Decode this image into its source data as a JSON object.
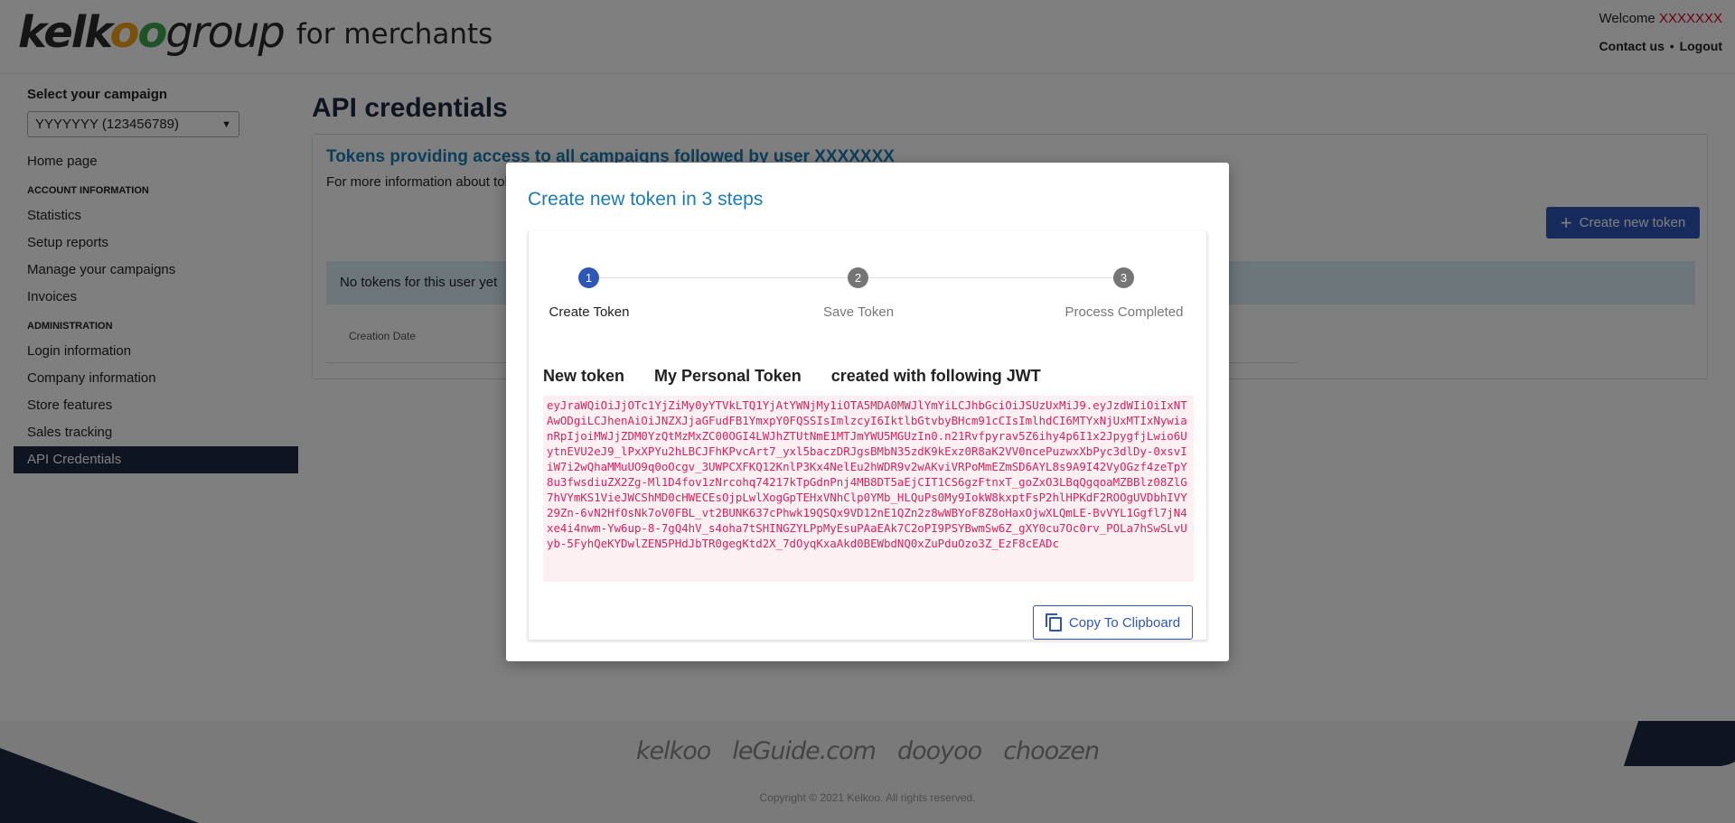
{
  "header": {
    "logo_brand": "kelkoo",
    "logo_group": "group",
    "logo_sub": "for merchants",
    "welcome_label": "Welcome",
    "welcome_user": "XXXXXXX",
    "contact_label": "Contact us",
    "separator": "•",
    "logout_label": "Logout"
  },
  "sidebar": {
    "campaign_label": "Select your campaign",
    "campaign_selected": "YYYYYYY (123456789)",
    "home": "Home page",
    "section_account": "ACCOUNT INFORMATION",
    "account_items": [
      "Statistics",
      "Setup reports",
      "Manage your campaigns",
      "Invoices"
    ],
    "section_admin": "ADMINISTRATION",
    "admin_items": [
      "Login information",
      "Company information",
      "Store features",
      "Sales tracking",
      "API Credentials"
    ]
  },
  "main": {
    "page_title": "API credentials",
    "card_title": "Tokens providing access to all campaigns followed by user XXXXXXX",
    "card_info": "For more information about toke",
    "create_button": "Create new token",
    "notice": "No tokens for this user yet",
    "column_creation_date": "Creation Date"
  },
  "footer": {
    "partners": [
      "kelkoo",
      "leGuide.com",
      "dooyoo",
      "choozen"
    ],
    "copyright": "Copyright © 2021 Kelkoo. All rights reserved."
  },
  "modal": {
    "title": "Create new token in 3 steps",
    "steps": [
      {
        "number": "1",
        "label": "Create Token",
        "active": true
      },
      {
        "number": "2",
        "label": "Save Token",
        "active": false
      },
      {
        "number": "3",
        "label": "Process Completed",
        "active": false
      }
    ],
    "heading_new_token": "New token",
    "heading_token_name": "My Personal Token",
    "heading_created_with": "created with following JWT",
    "jwt": "eyJraWQiOiJjOTc1YjZiMy0yYTVkLTQ1YjAtYWNjMy1iOTA5MDA0MWJlYmYiLCJhbGciOiJSUzUxMiJ9.eyJzdWIiOiIxNTAwODgiLCJhenAiOiJNZXJjaGFudFB1YmxpY0FQSSIsImlzcyI6IktlbGtvbyBHcm91cCIsImlhdCI6MTYxNjUxMTIxNywianRpIjoiMWJjZDM0YzQtMzMxZC00OGI4LWJhZTUtNmE1MTJmYWU5MGUzIn0.n21Rvfpyrav5Z6ihy4p6I1x2JpygfjLwio6UytnEVU2eJ9_lPxXPYu2hLBCJFhKPvcArt7_yxl5baczDRJgsBMbN35zdK9kExz0R8aK2VV0ncePuzwxXbPyc3dlDy-0xsvIiW7i2wQhaMMuUO9q0oOcgv_3UWPCXFKQ12KnlP3Kx4NelEu2hWDR9v2wAKviVRPoMmEZmSD6AYL8s9A9I42VyOGzf4zeTpY8u3fwsdiuZX2Zg-Ml1D4fov1zNrcohq74217kTpGdnPnj4MB8DT5aEjCIT1CS6gzFtnxT_goZxO3LBqQgqoaMZBBlz08ZlG7hVYmKS1VieJWCShMD0cHWECEsOjpLwlXogGpTEHxVNhClp0YMb_HLQuPs0My9IokW8kxptFsP2hlHPKdF2ROOgUVDbhIVY29Zn-6vN2HfOsNk7oV0FBL_vt2BUNK637cPhwk19QSQx9VD12nE1QZn2z8wWBYoF8Z8oHaxOjwXLQmLE-BvVYL1Ggfl7jN4xe4i4nwm-Yw6up-8-7gQ4hV_s4oha7tSHINGZYLPpMyEsuPAaEAk7C2oPI9PSYBwmSw6Z_gXY0cu7Oc0rv_POLa7hSwSLvUyb-5FyhQeKYDwlZEN5PHdJbTR0gegKtd2X_7dOyqKxaAkd0BEWbdNQ0xZuPduOzo3Z_EzF8cEADc",
    "copy_button": "Copy To Clipboard"
  }
}
